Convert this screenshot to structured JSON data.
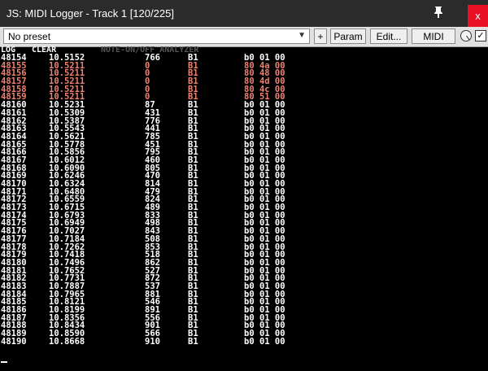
{
  "window": {
    "title": "JS: MIDI Logger - Track 1 [120/225]",
    "close_label": "x"
  },
  "toolbar": {
    "preset_value": "No preset",
    "plus_label": "+",
    "param_label": "Param",
    "edit_label": "Edit...",
    "midi_label": "MIDI",
    "check_mark": "✓"
  },
  "header": {
    "log_label": "LOG",
    "clear_label": "CLEAR",
    "analyzer_title": "NOTE-ON/OFF ANALYZER"
  },
  "colors": {
    "text": "#ffffff",
    "highlight": "#f08070",
    "background": "#000000"
  },
  "rows": [
    {
      "n": "48154",
      "t": "10.5152",
      "d": "766",
      "note": "B1",
      "bytes": "b0 01 00",
      "hl": false
    },
    {
      "n": "48155",
      "t": "10.5211",
      "d": "0",
      "note": "B1",
      "bytes": "80 4a 00",
      "hl": true
    },
    {
      "n": "48156",
      "t": "10.5211",
      "d": "0",
      "note": "B1",
      "bytes": "80 48 00",
      "hl": true
    },
    {
      "n": "48157",
      "t": "10.5211",
      "d": "0",
      "note": "B1",
      "bytes": "80 4d 00",
      "hl": true
    },
    {
      "n": "48158",
      "t": "10.5211",
      "d": "0",
      "note": "B1",
      "bytes": "80 4c 00",
      "hl": true
    },
    {
      "n": "48159",
      "t": "10.5211",
      "d": "0",
      "note": "B1",
      "bytes": "80 51 00",
      "hl": true
    },
    {
      "n": "48160",
      "t": "10.5231",
      "d": "87",
      "note": "B1",
      "bytes": "b0 01 00",
      "hl": false
    },
    {
      "n": "48161",
      "t": "10.5309",
      "d": "431",
      "note": "B1",
      "bytes": "b0 01 00",
      "hl": false
    },
    {
      "n": "48162",
      "t": "10.5387",
      "d": "776",
      "note": "B1",
      "bytes": "b0 01 00",
      "hl": false
    },
    {
      "n": "48163",
      "t": "10.5543",
      "d": "441",
      "note": "B1",
      "bytes": "b0 01 00",
      "hl": false
    },
    {
      "n": "48164",
      "t": "10.5621",
      "d": "785",
      "note": "B1",
      "bytes": "b0 01 00",
      "hl": false
    },
    {
      "n": "48165",
      "t": "10.5778",
      "d": "451",
      "note": "B1",
      "bytes": "b0 01 00",
      "hl": false
    },
    {
      "n": "48166",
      "t": "10.5856",
      "d": "795",
      "note": "B1",
      "bytes": "b0 01 00",
      "hl": false
    },
    {
      "n": "48167",
      "t": "10.6012",
      "d": "460",
      "note": "B1",
      "bytes": "b0 01 00",
      "hl": false
    },
    {
      "n": "48168",
      "t": "10.6090",
      "d": "805",
      "note": "B1",
      "bytes": "b0 01 00",
      "hl": false
    },
    {
      "n": "48169",
      "t": "10.6246",
      "d": "470",
      "note": "B1",
      "bytes": "b0 01 00",
      "hl": false
    },
    {
      "n": "48170",
      "t": "10.6324",
      "d": "814",
      "note": "B1",
      "bytes": "b0 01 00",
      "hl": false
    },
    {
      "n": "48171",
      "t": "10.6480",
      "d": "479",
      "note": "B1",
      "bytes": "b0 01 00",
      "hl": false
    },
    {
      "n": "48172",
      "t": "10.6559",
      "d": "824",
      "note": "B1",
      "bytes": "b0 01 00",
      "hl": false
    },
    {
      "n": "48173",
      "t": "10.6715",
      "d": "489",
      "note": "B1",
      "bytes": "b0 01 00",
      "hl": false
    },
    {
      "n": "48174",
      "t": "10.6793",
      "d": "833",
      "note": "B1",
      "bytes": "b0 01 00",
      "hl": false
    },
    {
      "n": "48175",
      "t": "10.6949",
      "d": "498",
      "note": "B1",
      "bytes": "b0 01 00",
      "hl": false
    },
    {
      "n": "48176",
      "t": "10.7027",
      "d": "843",
      "note": "B1",
      "bytes": "b0 01 00",
      "hl": false
    },
    {
      "n": "48177",
      "t": "10.7184",
      "d": "508",
      "note": "B1",
      "bytes": "b0 01 00",
      "hl": false
    },
    {
      "n": "48178",
      "t": "10.7262",
      "d": "853",
      "note": "B1",
      "bytes": "b0 01 00",
      "hl": false
    },
    {
      "n": "48179",
      "t": "10.7418",
      "d": "518",
      "note": "B1",
      "bytes": "b0 01 00",
      "hl": false
    },
    {
      "n": "48180",
      "t": "10.7496",
      "d": "862",
      "note": "B1",
      "bytes": "b0 01 00",
      "hl": false
    },
    {
      "n": "48181",
      "t": "10.7652",
      "d": "527",
      "note": "B1",
      "bytes": "b0 01 00",
      "hl": false
    },
    {
      "n": "48182",
      "t": "10.7731",
      "d": "872",
      "note": "B1",
      "bytes": "b0 01 00",
      "hl": false
    },
    {
      "n": "48183",
      "t": "10.7887",
      "d": "537",
      "note": "B1",
      "bytes": "b0 01 00",
      "hl": false
    },
    {
      "n": "48184",
      "t": "10.7965",
      "d": "881",
      "note": "B1",
      "bytes": "b0 01 00",
      "hl": false
    },
    {
      "n": "48185",
      "t": "10.8121",
      "d": "546",
      "note": "B1",
      "bytes": "b0 01 00",
      "hl": false
    },
    {
      "n": "48186",
      "t": "10.8199",
      "d": "891",
      "note": "B1",
      "bytes": "b0 01 00",
      "hl": false
    },
    {
      "n": "48187",
      "t": "10.8356",
      "d": "556",
      "note": "B1",
      "bytes": "b0 01 00",
      "hl": false
    },
    {
      "n": "48188",
      "t": "10.8434",
      "d": "901",
      "note": "B1",
      "bytes": "b0 01 00",
      "hl": false
    },
    {
      "n": "48189",
      "t": "10.8590",
      "d": "566",
      "note": "B1",
      "bytes": "b0 01 00",
      "hl": false
    },
    {
      "n": "48190",
      "t": "10.8668",
      "d": "910",
      "note": "B1",
      "bytes": "b0 01 00",
      "hl": false
    }
  ]
}
